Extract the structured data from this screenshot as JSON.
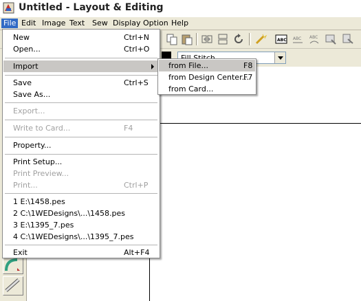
{
  "window": {
    "title": "Untitled - Layout & Editing"
  },
  "menubar": [
    "File",
    "Edit",
    "Image",
    "Text",
    "Sew",
    "Display",
    "Option",
    "Help"
  ],
  "toolbar": {
    "stitch_combo_value": "Fill Stitch"
  },
  "file_menu": {
    "new": {
      "label": "New",
      "shortcut": "Ctrl+N"
    },
    "open": {
      "label": "Open...",
      "shortcut": "Ctrl+O"
    },
    "import": {
      "label": "Import"
    },
    "save": {
      "label": "Save",
      "shortcut": "Ctrl+S"
    },
    "save_as": {
      "label": "Save As..."
    },
    "export": {
      "label": "Export..."
    },
    "write_to_card": {
      "label": "Write to Card...",
      "shortcut": "F4"
    },
    "property": {
      "label": "Property..."
    },
    "print_setup": {
      "label": "Print Setup..."
    },
    "print_preview": {
      "label": "Print Preview..."
    },
    "print": {
      "label": "Print...",
      "shortcut": "Ctrl+P"
    },
    "recent": [
      "1 E:\\1458.pes",
      "2 C:\\1WEDesigns\\...\\1458.pes",
      "3 E:\\1395_7.pes",
      "4 C:\\1WEDesigns\\...\\1395_7.pes"
    ],
    "exit": {
      "label": "Exit",
      "shortcut": "Alt+F4"
    }
  },
  "import_menu": {
    "from_file": {
      "label": "from File...",
      "shortcut": "F8"
    },
    "from_design_center": {
      "label": "from Design Center...",
      "shortcut": "F7"
    },
    "from_card": {
      "label": "from Card..."
    }
  }
}
